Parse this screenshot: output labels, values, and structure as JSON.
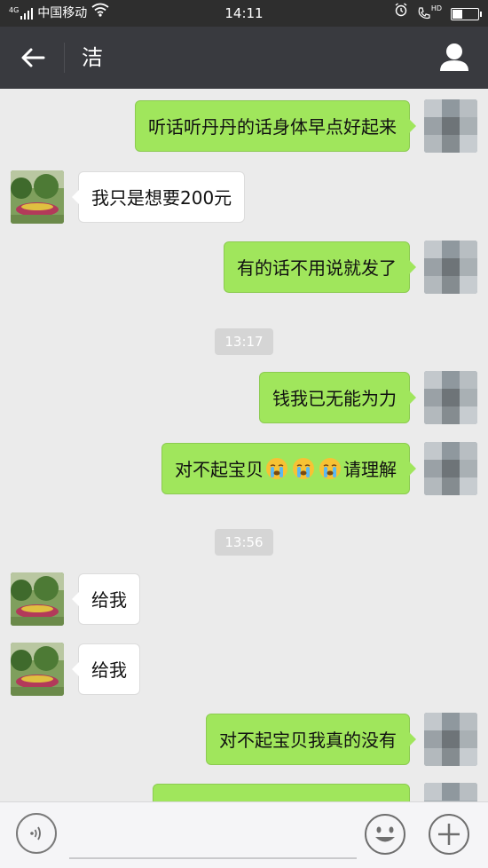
{
  "status_bar": {
    "signal_label": "4G",
    "carrier": "中国移动",
    "time": "14:11",
    "hd_label": "HD",
    "battery_level": 0.35,
    "icons": [
      "signal-icon",
      "wifi-icon",
      "alarm-icon",
      "call-hd-icon",
      "battery-icon"
    ]
  },
  "header": {
    "title": "洁",
    "back_icon": "back-arrow-icon",
    "profile_icon": "person-icon"
  },
  "messages": [
    {
      "side": "self",
      "text": "听话听丹丹的话身体早点好起来"
    },
    {
      "side": "other",
      "text": "我只是想要200元"
    },
    {
      "side": "self",
      "text": "有的话不用说就发了"
    },
    {
      "timestamp": "13:17"
    },
    {
      "side": "self",
      "text": "钱我已无能为力"
    },
    {
      "side": "self",
      "text_before": "对不起宝贝",
      "emoji": "crying-face",
      "emoji_count": 3,
      "text_after": "请理解"
    },
    {
      "timestamp": "13:56"
    },
    {
      "side": "other",
      "text": "给我"
    },
    {
      "side": "other",
      "text": "给我"
    },
    {
      "side": "self",
      "text": "对不起宝贝我真的没有"
    }
  ],
  "input_bar": {
    "voice_icon": "voice-icon",
    "text_value": "",
    "emoji_icon": "smiley-icon",
    "plus_icon": "plus-icon"
  },
  "colors": {
    "status_bar_bg": "#2e2e2e",
    "title_bar_bg": "#393a3f",
    "chat_bg": "#ebebeb",
    "self_bubble": "#a0e65c",
    "other_bubble": "#ffffff",
    "timestamp_bg": "#d5d5d5"
  }
}
